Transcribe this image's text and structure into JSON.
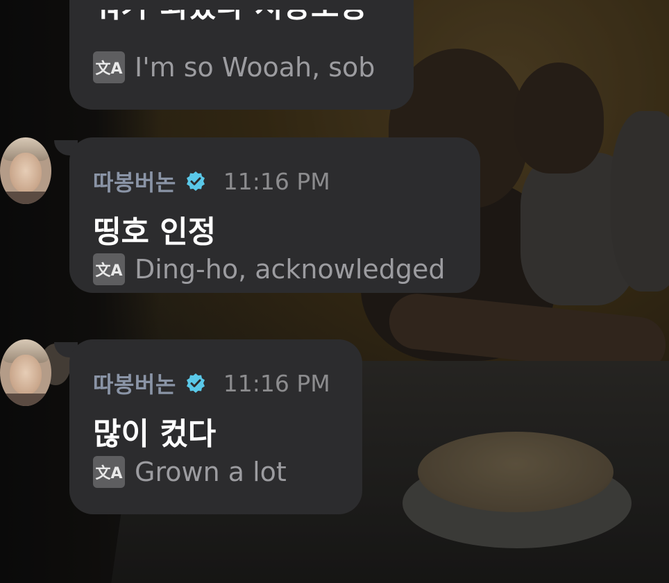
{
  "messages": [
    {
      "text_partial": "뭐가 되었나 서방오빵",
      "translation": "I'm so Wooah, sob"
    },
    {
      "sender": "따봉버논",
      "verified_icon": "verified-badge-icon",
      "time": "11:16 PM",
      "text": "띵호 인정",
      "translation": "Ding-ho, acknowledged"
    },
    {
      "sender": "따봉버논",
      "verified_icon": "verified-badge-icon",
      "time": "11:16 PM",
      "text": "많이 컸다",
      "translation": "Grown a lot"
    }
  ],
  "translate_icon_glyph": "文A",
  "colors": {
    "bubble": "#2c2c2e",
    "sender": "#8a94a6",
    "verified": "#5ac8e8",
    "time": "#8c8c8e",
    "translation": "#9c9ca0"
  }
}
